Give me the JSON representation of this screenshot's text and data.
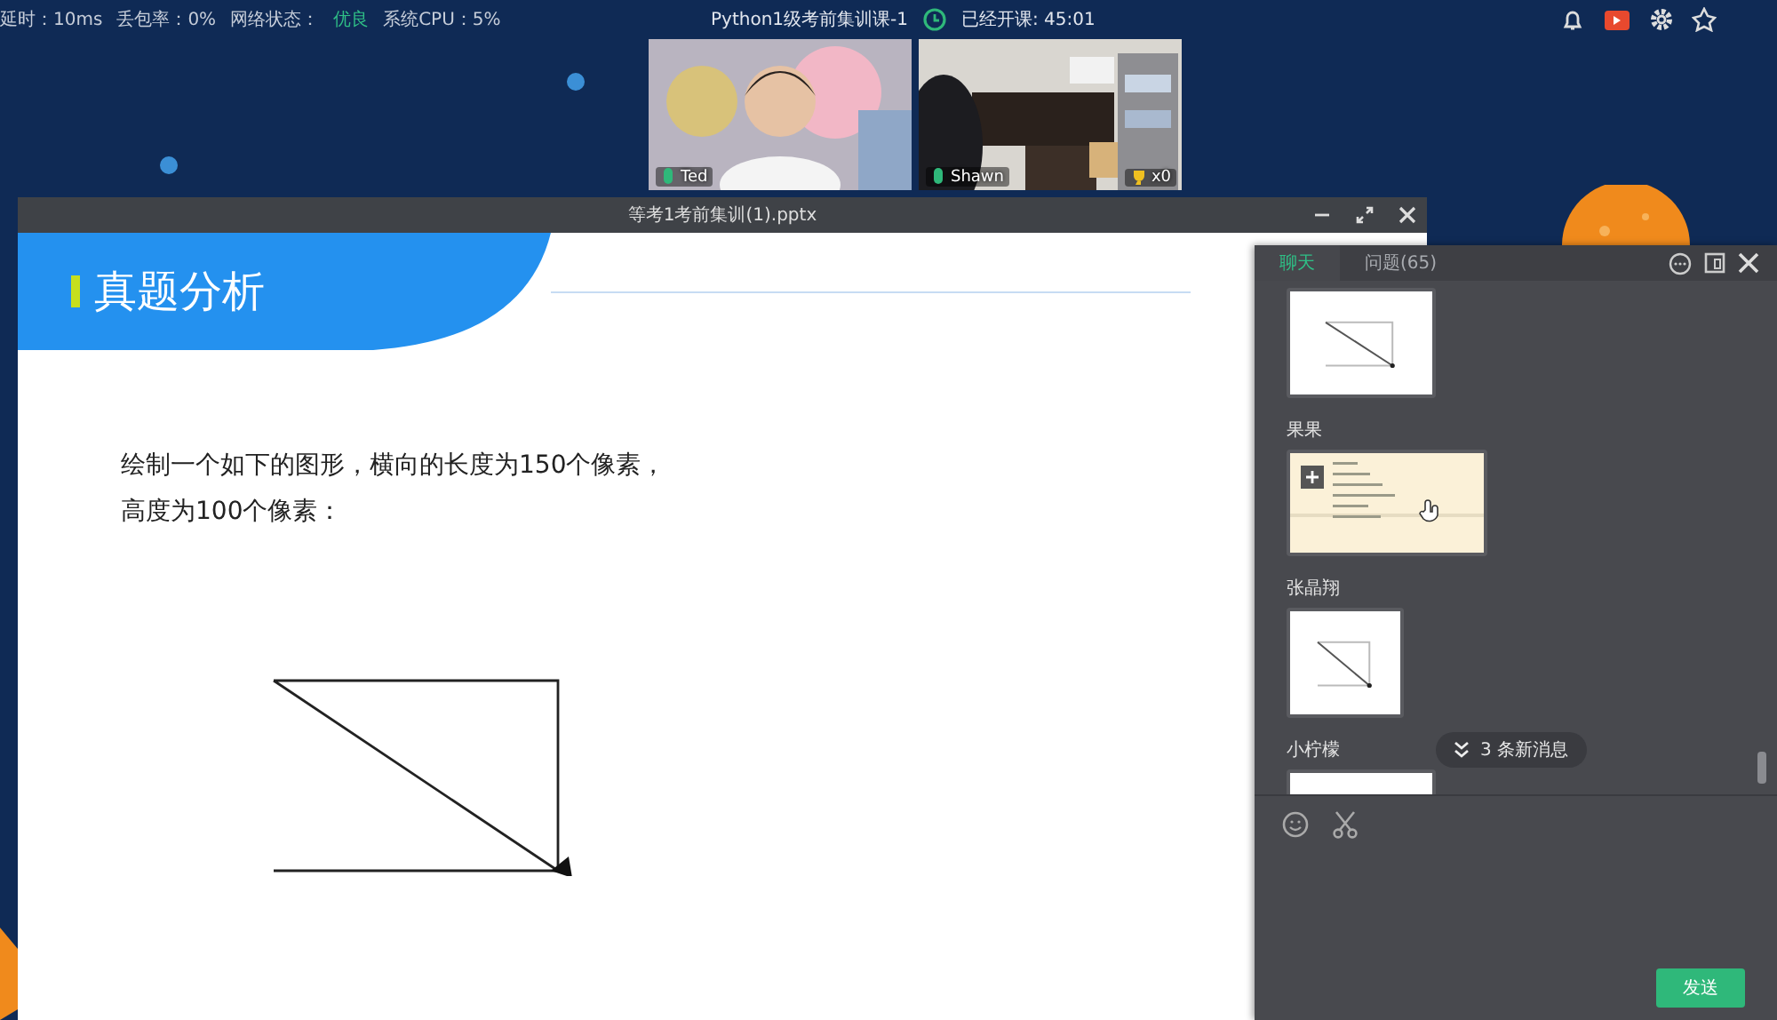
{
  "status_bar": {
    "stats": [
      {
        "text": "延时：10ms",
        "kind": "plain"
      },
      {
        "text": "丢包率：0%",
        "kind": "plain"
      },
      {
        "text": "网络状态：",
        "kind": "plain"
      },
      {
        "text": "优良",
        "kind": "good"
      },
      {
        "text": "系统CPU：5%",
        "kind": "plain"
      }
    ],
    "course_title": "Python1级考前集训课-1",
    "elapsed": "已经开课: 45:01"
  },
  "videos": [
    {
      "kind": "picture",
      "name": "Ted"
    },
    {
      "kind": "picture",
      "name": "Shawn",
      "trophies": "x0"
    }
  ],
  "slide_window": {
    "title": "等考1考前集训(1).pptx",
    "slide": {
      "heading": "真题分析",
      "paragraphs": [
        "绘制一个如下的图形，横向的长度为150个像素，",
        "高度为100个像素："
      ]
    }
  },
  "chat": {
    "tabs": [
      {
        "label": "聊天",
        "selected": true
      },
      {
        "label": "问题(65)",
        "selected": false
      }
    ],
    "messages": [
      {
        "kind": "diagram"
      },
      {
        "sender": "果果",
        "kind": "code"
      },
      {
        "sender": "张晶翔",
        "kind": "diagram"
      },
      {
        "sender": "小柠檬",
        "kind": "blank"
      }
    ],
    "new_messages": "3 条新消息",
    "send": "发送"
  }
}
